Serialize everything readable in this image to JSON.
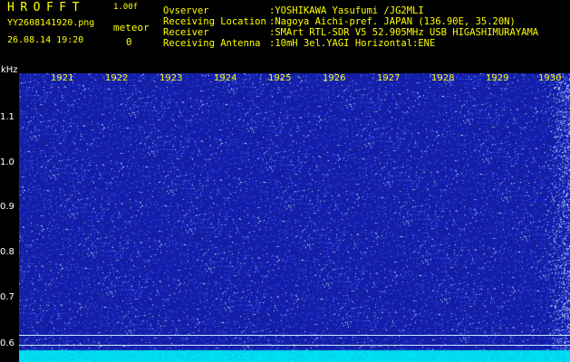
{
  "app": {
    "title": "HROFFT",
    "version": "1.00f"
  },
  "file": {
    "name": "YY2608141920.png",
    "datetime": "26.08.14 19:20"
  },
  "meteor": {
    "label": "meteor",
    "count": "0"
  },
  "info": [
    {
      "label": "Ovserver",
      "value": ":YOSHIKAWA Yasufumi /JG2MLI"
    },
    {
      "label": "Receiving Location",
      "value": ":Nagoya Aichi-pref. JAPAN (136.90E, 35.20N)"
    },
    {
      "label": "Receiver",
      "value": ":SMArt RTL-SDR V5 52.905MHz USB HIGASHIMURAYAMA"
    },
    {
      "label": "Receiving Antenna",
      "value": ":10mH 3el.YAGI Horizontal:ENE"
    }
  ],
  "axis": {
    "unit": "kHz",
    "yticks": [
      "1.1",
      "1.0",
      "0.9",
      "0.8",
      "0.7",
      "0.6"
    ],
    "time_marks": [
      "1921",
      "1922",
      "1923",
      "1924",
      "1925",
      "1926",
      "1927",
      "1928",
      "1929",
      "1930"
    ]
  },
  "colors": {
    "text_yellow": "#ffff00",
    "spectrum_bg": "#1a2aa8",
    "baseline_cyan": "#00e5ff"
  }
}
